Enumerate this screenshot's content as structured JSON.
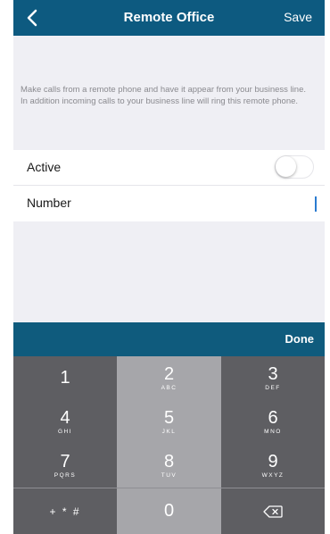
{
  "header": {
    "back_icon": "chevron-left-icon",
    "title": "Remote Office",
    "save_label": "Save"
  },
  "description": {
    "line1": "Make calls from a remote phone and have it appear from your business line.",
    "line2": "In addition incoming calls to your business line will ring this remote phone."
  },
  "settings": {
    "active_label": "Active",
    "active_on": false,
    "number_label": "Number",
    "number_value": ""
  },
  "keyboard": {
    "done_label": "Done",
    "keys": [
      {
        "digit": "1",
        "letters": ""
      },
      {
        "digit": "2",
        "letters": "ABC"
      },
      {
        "digit": "3",
        "letters": "DEF"
      },
      {
        "digit": "4",
        "letters": "GHI"
      },
      {
        "digit": "5",
        "letters": "JKL"
      },
      {
        "digit": "6",
        "letters": "MNO"
      },
      {
        "digit": "7",
        "letters": "PQRS"
      },
      {
        "digit": "8",
        "letters": "TUV"
      },
      {
        "digit": "9",
        "letters": "WXYZ"
      }
    ],
    "symbols_label": "+ * #",
    "zero_label": "0",
    "delete_icon": "backspace-icon"
  },
  "colors": {
    "nav_background": "#0d5a80",
    "done_bar": "#0f5b7d",
    "screen_background": "#efeff4",
    "keypad_background": "#8e8e93"
  }
}
